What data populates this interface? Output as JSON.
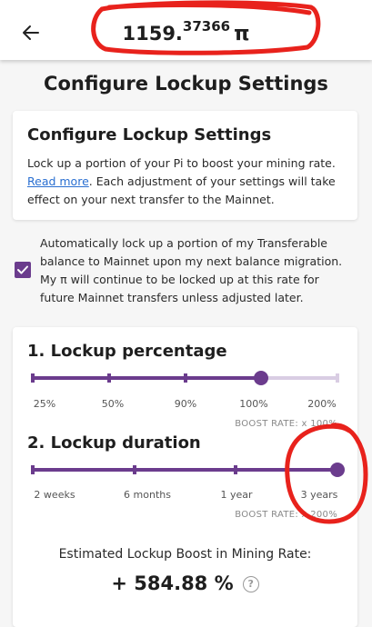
{
  "header": {
    "balance_int": "1159.",
    "balance_dec": "37366",
    "currency_symbol": "π",
    "back_icon": "arrow-left-icon"
  },
  "page_title": "Configure Lockup Settings",
  "info_card": {
    "title": "Configure Lockup Settings",
    "text_before_link": "Lock up a portion of your Pi to boost your mining rate. ",
    "link": "Read more",
    "text_after_link": ". Each adjustment of your settings will take effect on your next transfer to the Mainnet."
  },
  "auto_lock": {
    "checked": true,
    "text": "Automatically lock up a portion of my Transferable balance to Mainnet upon my next balance migration. My π will continue to be locked up at this rate for future Mainnet transfers unless adjusted later."
  },
  "lockup_percentage": {
    "title": "1. Lockup percentage",
    "options": [
      "25%",
      "50%",
      "90%",
      "100%",
      "200%"
    ],
    "selected_index": 3,
    "boost_rate": "BOOST RATE: x 100%"
  },
  "lockup_duration": {
    "title": "2. Lockup duration",
    "options": [
      "2 weeks",
      "6 months",
      "1 year",
      "3 years"
    ],
    "selected_index": 3,
    "boost_rate": "BOOST RATE: x 200%"
  },
  "estimate": {
    "label": "Estimated Lockup Boost in Mining Rate:",
    "value": "+ 584.88 %",
    "help_icon": "question-circle-icon"
  },
  "colors": {
    "accent": "#6b3c8d",
    "track_inactive": "#d9cde3",
    "link": "#2a6fd1",
    "annotation_red": "#e8221c"
  }
}
